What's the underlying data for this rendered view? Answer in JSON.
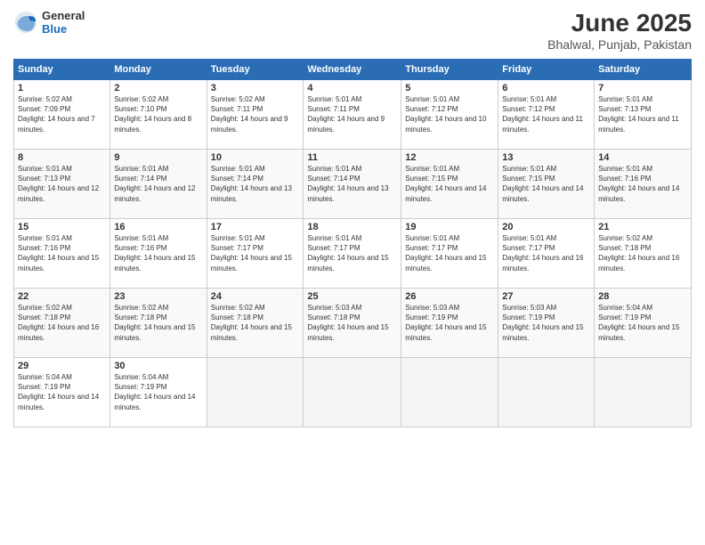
{
  "header": {
    "logo": {
      "general": "General",
      "blue": "Blue"
    },
    "title": "June 2025",
    "location": "Bhalwal, Punjab, Pakistan"
  },
  "calendar": {
    "days_of_week": [
      "Sunday",
      "Monday",
      "Tuesday",
      "Wednesday",
      "Thursday",
      "Friday",
      "Saturday"
    ],
    "weeks": [
      [
        {
          "day": null,
          "info": null
        },
        {
          "day": "2",
          "sunrise": "5:02 AM",
          "sunset": "7:10 PM",
          "daylight": "14 hours and 8 minutes."
        },
        {
          "day": "3",
          "sunrise": "5:02 AM",
          "sunset": "7:11 PM",
          "daylight": "14 hours and 9 minutes."
        },
        {
          "day": "4",
          "sunrise": "5:01 AM",
          "sunset": "7:11 PM",
          "daylight": "14 hours and 9 minutes."
        },
        {
          "day": "5",
          "sunrise": "5:01 AM",
          "sunset": "7:12 PM",
          "daylight": "14 hours and 10 minutes."
        },
        {
          "day": "6",
          "sunrise": "5:01 AM",
          "sunset": "7:12 PM",
          "daylight": "14 hours and 11 minutes."
        },
        {
          "day": "7",
          "sunrise": "5:01 AM",
          "sunset": "7:13 PM",
          "daylight": "14 hours and 11 minutes."
        }
      ],
      [
        {
          "day": "8",
          "sunrise": "5:01 AM",
          "sunset": "7:13 PM",
          "daylight": "14 hours and 12 minutes."
        },
        {
          "day": "9",
          "sunrise": "5:01 AM",
          "sunset": "7:14 PM",
          "daylight": "14 hours and 12 minutes."
        },
        {
          "day": "10",
          "sunrise": "5:01 AM",
          "sunset": "7:14 PM",
          "daylight": "14 hours and 13 minutes."
        },
        {
          "day": "11",
          "sunrise": "5:01 AM",
          "sunset": "7:14 PM",
          "daylight": "14 hours and 13 minutes."
        },
        {
          "day": "12",
          "sunrise": "5:01 AM",
          "sunset": "7:15 PM",
          "daylight": "14 hours and 14 minutes."
        },
        {
          "day": "13",
          "sunrise": "5:01 AM",
          "sunset": "7:15 PM",
          "daylight": "14 hours and 14 minutes."
        },
        {
          "day": "14",
          "sunrise": "5:01 AM",
          "sunset": "7:16 PM",
          "daylight": "14 hours and 14 minutes."
        }
      ],
      [
        {
          "day": "15",
          "sunrise": "5:01 AM",
          "sunset": "7:16 PM",
          "daylight": "14 hours and 15 minutes."
        },
        {
          "day": "16",
          "sunrise": "5:01 AM",
          "sunset": "7:16 PM",
          "daylight": "14 hours and 15 minutes."
        },
        {
          "day": "17",
          "sunrise": "5:01 AM",
          "sunset": "7:17 PM",
          "daylight": "14 hours and 15 minutes."
        },
        {
          "day": "18",
          "sunrise": "5:01 AM",
          "sunset": "7:17 PM",
          "daylight": "14 hours and 15 minutes."
        },
        {
          "day": "19",
          "sunrise": "5:01 AM",
          "sunset": "7:17 PM",
          "daylight": "14 hours and 15 minutes."
        },
        {
          "day": "20",
          "sunrise": "5:01 AM",
          "sunset": "7:17 PM",
          "daylight": "14 hours and 16 minutes."
        },
        {
          "day": "21",
          "sunrise": "5:02 AM",
          "sunset": "7:18 PM",
          "daylight": "14 hours and 16 minutes."
        }
      ],
      [
        {
          "day": "22",
          "sunrise": "5:02 AM",
          "sunset": "7:18 PM",
          "daylight": "14 hours and 16 minutes."
        },
        {
          "day": "23",
          "sunrise": "5:02 AM",
          "sunset": "7:18 PM",
          "daylight": "14 hours and 15 minutes."
        },
        {
          "day": "24",
          "sunrise": "5:02 AM",
          "sunset": "7:18 PM",
          "daylight": "14 hours and 15 minutes."
        },
        {
          "day": "25",
          "sunrise": "5:03 AM",
          "sunset": "7:18 PM",
          "daylight": "14 hours and 15 minutes."
        },
        {
          "day": "26",
          "sunrise": "5:03 AM",
          "sunset": "7:19 PM",
          "daylight": "14 hours and 15 minutes."
        },
        {
          "day": "27",
          "sunrise": "5:03 AM",
          "sunset": "7:19 PM",
          "daylight": "14 hours and 15 minutes."
        },
        {
          "day": "28",
          "sunrise": "5:04 AM",
          "sunset": "7:19 PM",
          "daylight": "14 hours and 15 minutes."
        }
      ],
      [
        {
          "day": "29",
          "sunrise": "5:04 AM",
          "sunset": "7:19 PM",
          "daylight": "14 hours and 14 minutes."
        },
        {
          "day": "30",
          "sunrise": "5:04 AM",
          "sunset": "7:19 PM",
          "daylight": "14 hours and 14 minutes."
        },
        {
          "day": null,
          "info": null
        },
        {
          "day": null,
          "info": null
        },
        {
          "day": null,
          "info": null
        },
        {
          "day": null,
          "info": null
        },
        {
          "day": null,
          "info": null
        }
      ]
    ],
    "first_week": [
      {
        "day": "1",
        "sunrise": "5:02 AM",
        "sunset": "7:09 PM",
        "daylight": "14 hours and 7 minutes."
      }
    ]
  }
}
